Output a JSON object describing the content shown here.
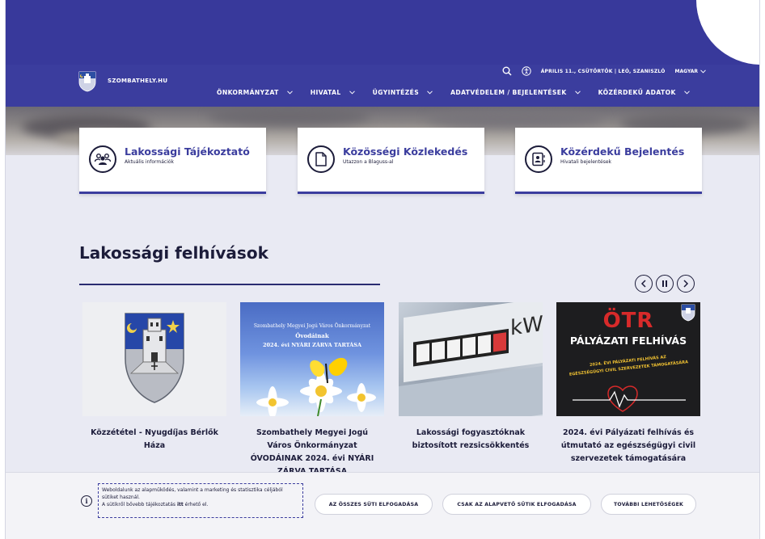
{
  "header": {
    "site_name": "SZOMBATHELY.HU",
    "date_text": "ÁPRILIS 11., CSÜTÖRTÖK | LEÓ, SZANISZLÓ",
    "language": "MAGYAR",
    "menu": [
      {
        "label": "ÖNKORMÁNYZAT"
      },
      {
        "label": "HIVATAL"
      },
      {
        "label": "ÜGYINTÉZÉS"
      },
      {
        "label": "ADATVÉDELEM / BEJELENTÉSEK"
      },
      {
        "label": "KÖZÉRDEKŰ ADATOK"
      }
    ]
  },
  "cards": [
    {
      "title": "Lakossági Tájékoztató",
      "subtitle": "Aktuális információk",
      "icon": "people-icon"
    },
    {
      "title": "Közösségi Közlekedés",
      "subtitle": "Utazzon a Blaguss-al",
      "icon": "document-icon"
    },
    {
      "title": "Közérdekű Bejelentés",
      "subtitle": "Hivatali bejelentések",
      "icon": "id-card-icon"
    }
  ],
  "section": {
    "title": "Lakossági felhívások"
  },
  "news": [
    {
      "caption": "Közzététel - Nyugdíjas Bérlők Háza",
      "thumb_text": []
    },
    {
      "caption": "Szombathely Megyei Jogú Város Önkormányzat ÓVODÁINAK 2024. évi NYÁRI ZÁRVA TARTÁSA",
      "thumb_text": [
        "Szombathely Megyei Jogú Város Önkormányzat",
        "Óvodáinak",
        "2024. évi NYÁRI ZÁRVA TARTÁSA"
      ]
    },
    {
      "caption": "Lakossági fogyasztóknak biztosított rezsicsökkentés",
      "thumb_text": [
        "kW"
      ]
    },
    {
      "caption": "2024. évi Pályázati felhívás és útmutató az egészségügyi civil szervezetek támogatására",
      "thumb_text": [
        "ÖTR",
        "PÁLYÁZATI FELHÍVÁS",
        "2024. ÉVI PÁLYÁZATI FELHÍVÁS AZ",
        "EGÉSZSÉGÜGYI CIVIL SZERVEZETEK TÁMOGATÁSÁRA"
      ]
    }
  ],
  "cookie": {
    "line1": "Weboldalunk az alapműködés, valamint a marketing és statisztika céljából sütiket használ.",
    "line2_pre": "A sütikről bővebb tájékoztatás ",
    "line2_link": "itt",
    "line2_post": " érhető el.",
    "accept_all": "AZ ÖSSZES SÜTI ELFOGADÁSA",
    "accept_basic": "CSAK AZ ALAPVETŐ SÜTIK ELFOGADÁSA",
    "more": "TOVÁBBI LEHETŐSÉGEK"
  },
  "colors": {
    "brand": "#3b3d9e",
    "text": "#1c1c3a",
    "background": "#e9eaf3"
  }
}
